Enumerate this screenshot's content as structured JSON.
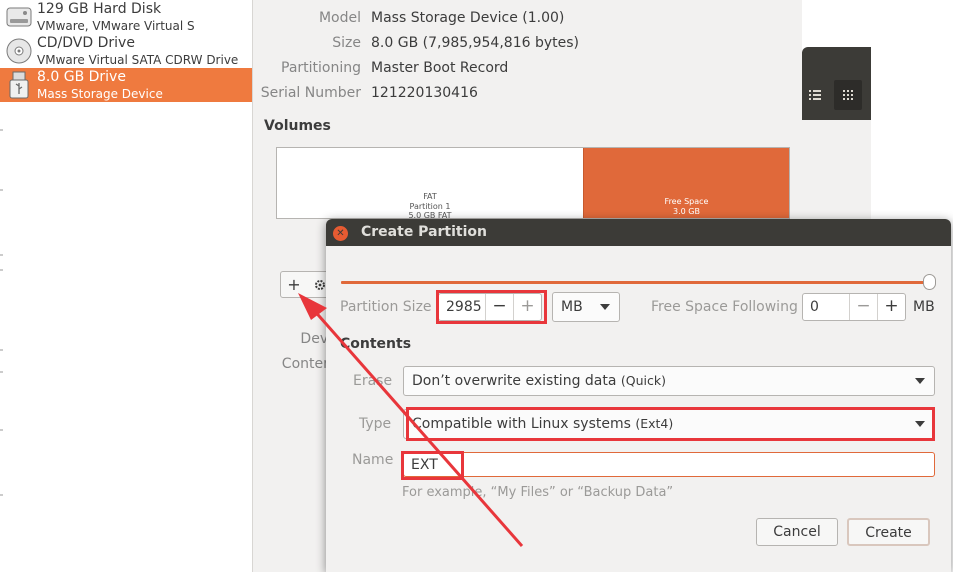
{
  "devices": [
    {
      "name": "129 GB Hard Disk",
      "detail": "VMware, VMware Virtual S",
      "icon": "hard-disk-icon"
    },
    {
      "name": "CD/DVD Drive",
      "detail": "VMware Virtual SATA CDRW Drive",
      "icon": "optical-drive-icon"
    },
    {
      "name": "8.0 GB Drive",
      "detail": "Mass Storage Device",
      "icon": "usb-drive-icon",
      "selected": true
    }
  ],
  "disk_info": [
    {
      "label": "Model",
      "value": "Mass Storage Device (1.00)"
    },
    {
      "label": "Size",
      "value": "8.0 GB (7,985,954,816 bytes)"
    },
    {
      "label": "Partitioning",
      "value": "Master Boot Record"
    },
    {
      "label": "Serial Number",
      "value": "121220130416"
    }
  ],
  "volumes": {
    "heading": "Volumes",
    "fat_segment": [
      "FAT",
      "Partition 1",
      "5.0 GB FAT"
    ],
    "free_segment": [
      "Free Space",
      "3.0 GB"
    ],
    "tools": {
      "add": "+",
      "settings_icon": "gears-icon"
    },
    "partial_labels": {
      "device": "Devi",
      "contents": "Conten"
    }
  },
  "dialog": {
    "title": "Create Partition",
    "partition_size_label": "Partition Size",
    "partition_size_value": "2985",
    "minus": "−",
    "plus": "+",
    "unit": "MB",
    "free_space_label": "Free Space Following",
    "free_space_value": "0",
    "free_space_unit": "MB",
    "contents_heading": "Contents",
    "erase_label": "Erase",
    "erase_value": "Don’t overwrite existing data",
    "erase_note": "(Quick)",
    "type_label": "Type",
    "type_value": "Compatible with Linux systems",
    "type_note": "(Ext4)",
    "name_label": "Name",
    "name_value": "EXT",
    "hint": "For example, “My Files” or “Backup Data”",
    "cancel": "Cancel",
    "create": "Create",
    "slider_fraction": 0.999
  },
  "colors": {
    "accent": "#e0693a",
    "selected_row": "#ef7a3f",
    "titlebar": "#3c3b37",
    "annotation_red": "#e8363b"
  }
}
